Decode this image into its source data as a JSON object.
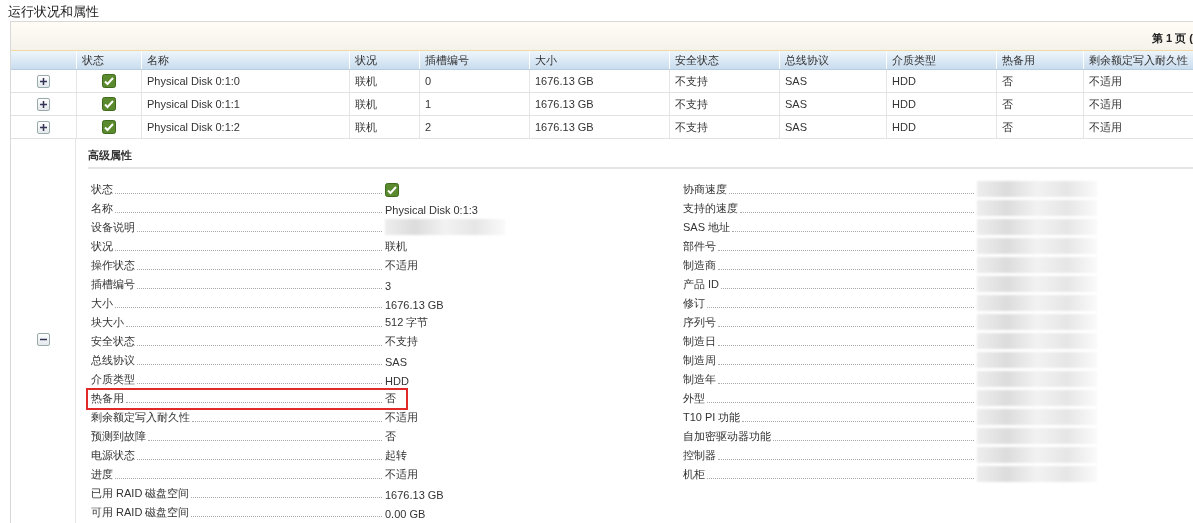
{
  "section_title": "运行状况和属性",
  "pager": {
    "label": "第 1 页 ("
  },
  "table": {
    "columns": [
      "状态",
      "名称",
      "状况",
      "插槽编号",
      "大小",
      "安全状态",
      "总线协议",
      "介质类型",
      "热备用",
      "剩余额定写入耐久性"
    ],
    "rows": [
      {
        "expanded": false,
        "status_ok": true,
        "cells": [
          "Physical Disk 0:1:0",
          "联机",
          "0",
          "1676.13 GB",
          "不支持",
          "SAS",
          "HDD",
          "否",
          "不适用"
        ]
      },
      {
        "expanded": false,
        "status_ok": true,
        "cells": [
          "Physical Disk 0:1:1",
          "联机",
          "1",
          "1676.13 GB",
          "不支持",
          "SAS",
          "HDD",
          "否",
          "不适用"
        ]
      },
      {
        "expanded": false,
        "status_ok": true,
        "cells": [
          "Physical Disk 0:1:2",
          "联机",
          "2",
          "1676.13 GB",
          "不支持",
          "SAS",
          "HDD",
          "否",
          "不适用"
        ]
      },
      {
        "expanded": true,
        "details": {
          "title": "高级属性",
          "left": [
            {
              "label": "状态",
              "kind": "status",
              "status_ok": true
            },
            {
              "label": "名称",
              "kind": "text",
              "value": "Physical Disk 0:1:3"
            },
            {
              "label": "设备说明",
              "kind": "blurred"
            },
            {
              "label": "状况",
              "kind": "text",
              "value": "联机"
            },
            {
              "label": "操作状态",
              "kind": "text",
              "value": "不适用"
            },
            {
              "label": "插槽编号",
              "kind": "text",
              "value": "3"
            },
            {
              "label": "大小",
              "kind": "text",
              "value": "1676.13 GB"
            },
            {
              "label": "块大小",
              "kind": "text",
              "value": "512 字节"
            },
            {
              "label": "安全状态",
              "kind": "text",
              "value": "不支持"
            },
            {
              "label": "总线协议",
              "kind": "text",
              "value": "SAS"
            },
            {
              "label": "介质类型",
              "kind": "text",
              "value": "HDD"
            },
            {
              "label": "热备用",
              "kind": "text",
              "value": "否",
              "highlighted": true
            },
            {
              "label": "剩余额定写入耐久性",
              "kind": "text",
              "value": "不适用"
            },
            {
              "label": "预测到故障",
              "kind": "text",
              "value": "否"
            },
            {
              "label": "电源状态",
              "kind": "text",
              "value": "起转"
            },
            {
              "label": "进度",
              "kind": "text",
              "value": "不适用"
            },
            {
              "label": "已用 RAID 磁盘空间",
              "kind": "text",
              "value": "1676.13 GB"
            },
            {
              "label": "可用 RAID 磁盘空间",
              "kind": "text",
              "value": "0.00 GB"
            }
          ],
          "right": [
            {
              "label": "协商速度",
              "kind": "blurred"
            },
            {
              "label": "支持的速度",
              "kind": "blurred"
            },
            {
              "label": "SAS 地址",
              "kind": "blurred"
            },
            {
              "label": "部件号",
              "kind": "blurred"
            },
            {
              "label": "制造商",
              "kind": "blurred"
            },
            {
              "label": "产品 ID",
              "kind": "blurred"
            },
            {
              "label": "修订",
              "kind": "blurred"
            },
            {
              "label": "序列号",
              "kind": "blurred"
            },
            {
              "label": "制造日",
              "kind": "blurred"
            },
            {
              "label": "制造周",
              "kind": "blurred"
            },
            {
              "label": "制造年",
              "kind": "blurred"
            },
            {
              "label": "外型",
              "kind": "blurred"
            },
            {
              "label": "T10 PI 功能",
              "kind": "blurred"
            },
            {
              "label": "自加密驱动器功能",
              "kind": "blurred"
            },
            {
              "label": "控制器",
              "kind": "blurred"
            },
            {
              "label": "机柜",
              "kind": "blurred"
            }
          ]
        }
      }
    ]
  }
}
